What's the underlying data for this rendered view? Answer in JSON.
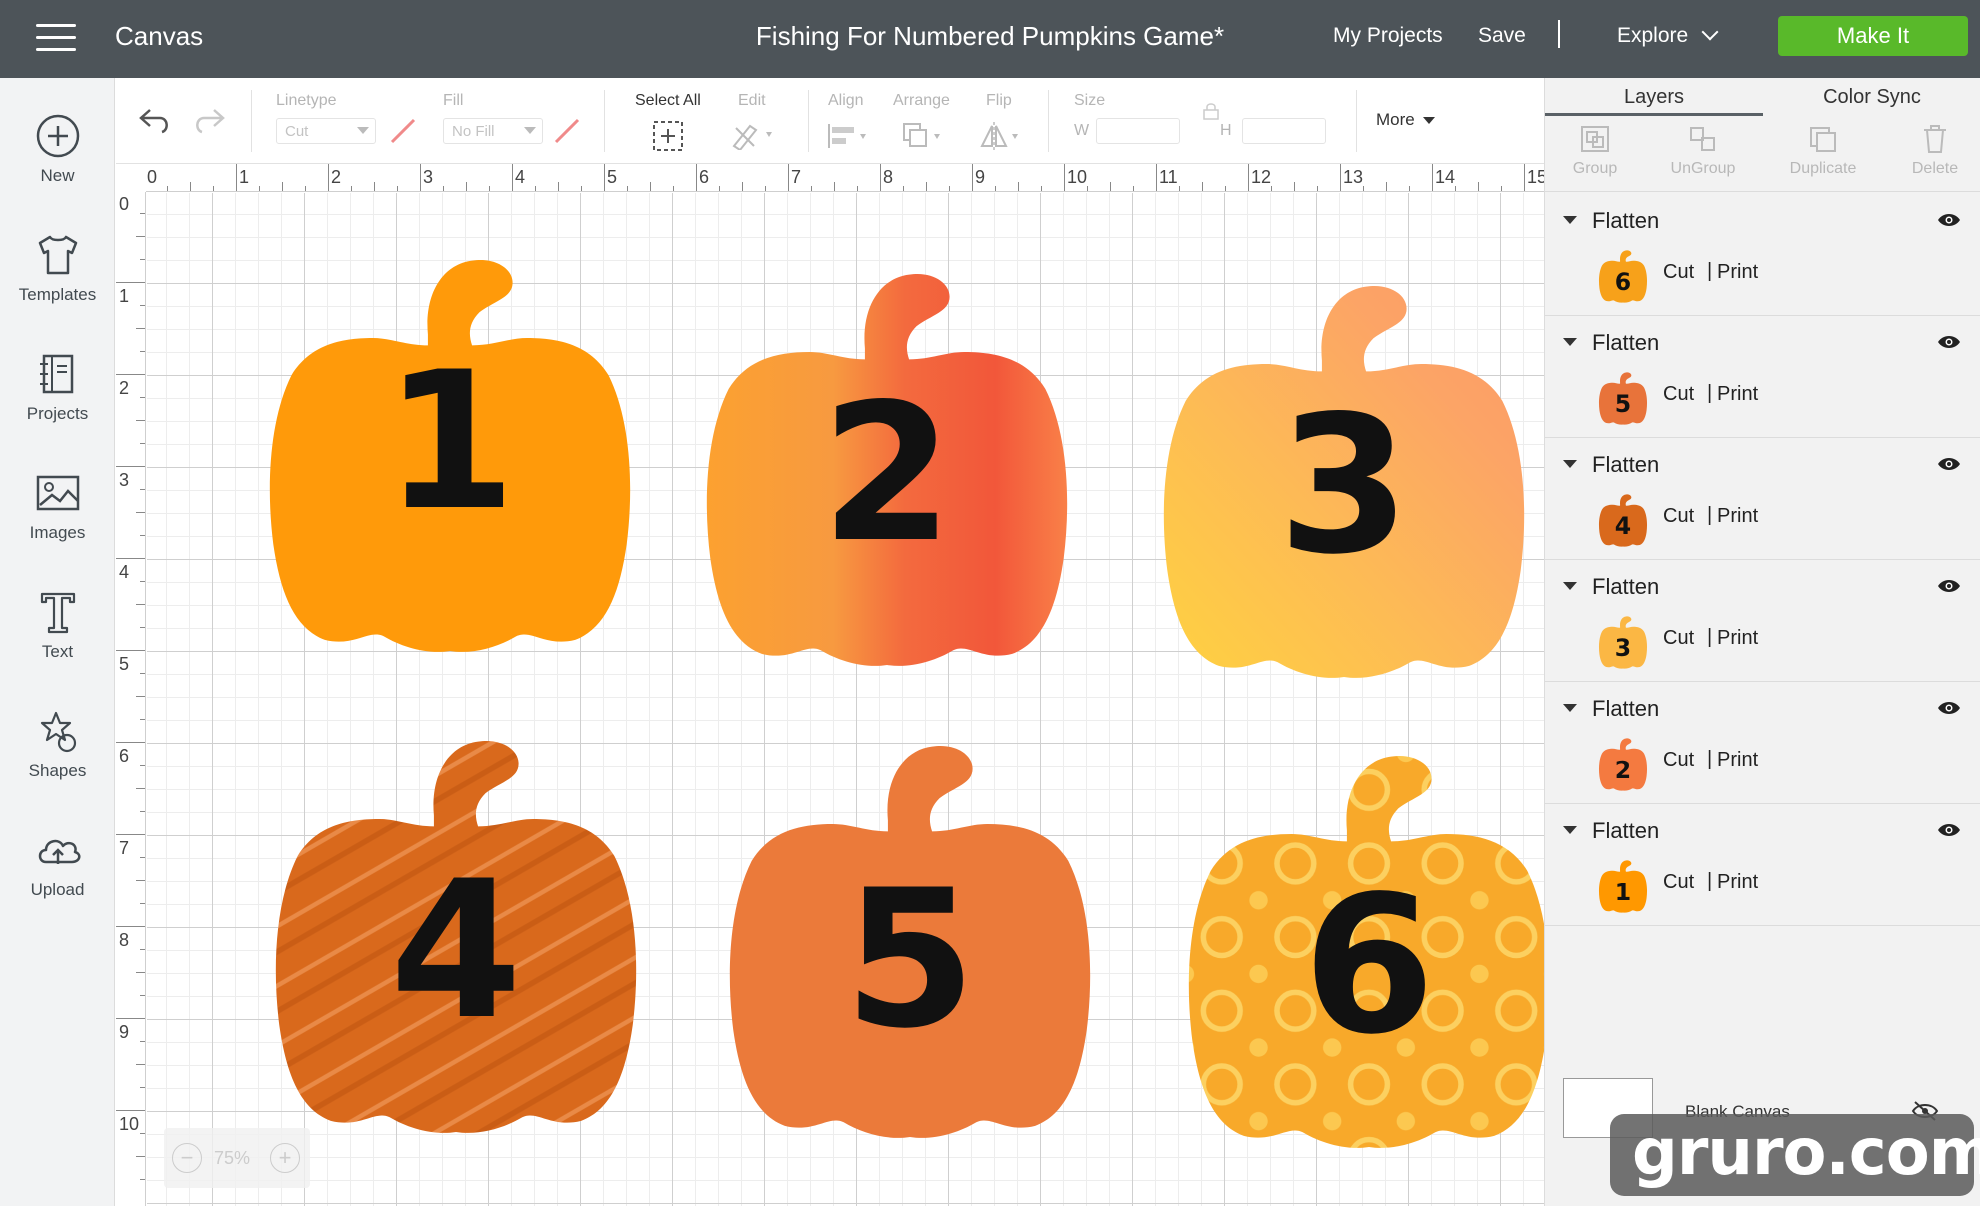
{
  "header": {
    "app_name": "Canvas",
    "project_title": "Fishing For Numbered Pumpkins Game*",
    "my_projects": "My Projects",
    "save": "Save",
    "separator": "|",
    "explore": "Explore",
    "make_it": "Make It",
    "make_it_color": "#59b92a"
  },
  "sidebar": {
    "items": [
      {
        "label": "New",
        "icon": "plus-circle-icon"
      },
      {
        "label": "Templates",
        "icon": "tshirt-icon"
      },
      {
        "label": "Projects",
        "icon": "projects-book-icon"
      },
      {
        "label": "Images",
        "icon": "image-icon"
      },
      {
        "label": "Text",
        "icon": "text-t-icon"
      },
      {
        "label": "Shapes",
        "icon": "shapes-icon"
      },
      {
        "label": "Upload",
        "icon": "cloud-upload-icon"
      }
    ]
  },
  "toolbar": {
    "linetype_label": "Linetype",
    "linetype_value": "Cut",
    "fill_label": "Fill",
    "fill_value": "No Fill",
    "select_all": "Select All",
    "edit": "Edit",
    "align": "Align",
    "arrange": "Arrange",
    "flip": "Flip",
    "size": "Size",
    "w": "W",
    "h": "H",
    "more": "More"
  },
  "rulers": {
    "top": [
      "0",
      "1",
      "2",
      "3",
      "4",
      "5",
      "6",
      "7",
      "8",
      "9",
      "10",
      "11",
      "12",
      "13",
      "14",
      "15"
    ],
    "left": [
      "0",
      "1",
      "2",
      "3",
      "4",
      "5",
      "6",
      "7",
      "8",
      "9",
      "10"
    ]
  },
  "canvas": {
    "pumpkins": [
      {
        "number": "1",
        "style": "solid-orange"
      },
      {
        "number": "2",
        "style": "watercolor-red-orange"
      },
      {
        "number": "3",
        "style": "watercolor-peach-yellow"
      },
      {
        "number": "4",
        "style": "scratched-dark-orange"
      },
      {
        "number": "5",
        "style": "solid-burnt-orange"
      },
      {
        "number": "6",
        "style": "patterned-yellow-orange"
      }
    ],
    "zoom": {
      "minus": "−",
      "value": "75%",
      "plus": "+"
    }
  },
  "panel": {
    "tabs": [
      {
        "label": "Layers"
      },
      {
        "label": "Color Sync"
      }
    ],
    "tools": [
      {
        "label": "Group",
        "icon": "group-icon"
      },
      {
        "label": "UnGroup",
        "icon": "ungroup-icon"
      },
      {
        "label": "Duplicate",
        "icon": "duplicate-icon"
      },
      {
        "label": "Delete",
        "icon": "trash-icon"
      }
    ],
    "layers": [
      {
        "name": "Flatten",
        "thumb_number": "6",
        "cut": "Cut",
        "pipe": "|",
        "print": "Print",
        "color": "#f7a11a"
      },
      {
        "name": "Flatten",
        "thumb_number": "5",
        "cut": "Cut",
        "pipe": "|",
        "print": "Print",
        "color": "#e8733a"
      },
      {
        "name": "Flatten",
        "thumb_number": "4",
        "cut": "Cut",
        "pipe": "|",
        "print": "Print",
        "color": "#d9691c"
      },
      {
        "name": "Flatten",
        "thumb_number": "3",
        "cut": "Cut",
        "pipe": "|",
        "print": "Print",
        "color": "#fbb744"
      },
      {
        "name": "Flatten",
        "thumb_number": "2",
        "cut": "Cut",
        "pipe": "|",
        "print": "Print",
        "color": "#f47a40"
      },
      {
        "name": "Flatten",
        "thumb_number": "1",
        "cut": "Cut",
        "pipe": "|",
        "print": "Print",
        "color": "#ff9800"
      }
    ],
    "blank_canvas": "Blank Canvas"
  },
  "watermark": "gruro.com"
}
